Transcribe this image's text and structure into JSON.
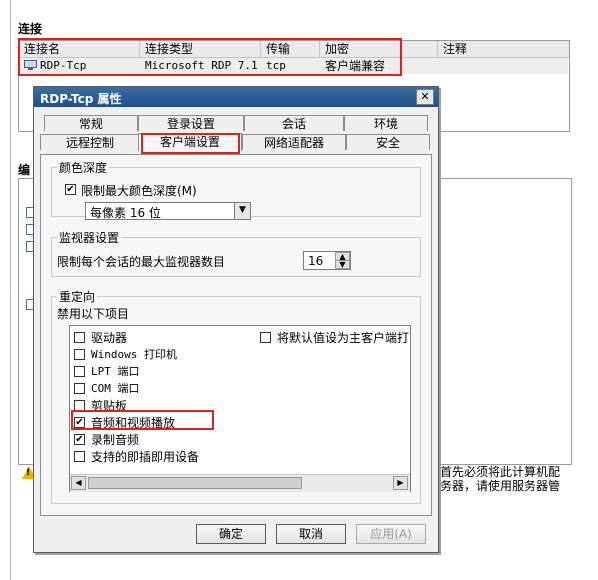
{
  "connections": {
    "title": "连接",
    "columns": [
      "连接名",
      "连接类型",
      "传输",
      "加密",
      "注释"
    ],
    "row": {
      "name": "RDP-Tcp",
      "type": "Microsoft RDP 7.1",
      "transport": "tcp",
      "encryption": "客户端兼容",
      "comment": ""
    }
  },
  "edit_title": "编",
  "warning": {
    "line1": "首先必须将此计算机配",
    "line2": "务器，请使用服务器管"
  },
  "dialog": {
    "title": "RDP-Tcp 属性",
    "close": "✕",
    "tabs_row1": [
      "常规",
      "登录设置",
      "会话",
      "环境"
    ],
    "tabs_row2": [
      "远程控制",
      "客户端设置",
      "网络适配器",
      "安全"
    ],
    "active_tab": "客户端设置",
    "color_depth": {
      "group": "颜色深度",
      "limit_label": "限制最大颜色深度(M)",
      "limit_checked": true,
      "value": "每像素 16 位"
    },
    "monitor": {
      "group": "监视器设置",
      "label": "限制每个会话的最大监视器数目",
      "value": "16"
    },
    "redirect": {
      "group": "重定向",
      "disable_label": "禁用以下项目",
      "items": [
        {
          "label": "驱动器",
          "checked": false
        },
        {
          "label": "Windows 打印机",
          "checked": false
        },
        {
          "label": "LPT 端口",
          "checked": false
        },
        {
          "label": "COM 端口",
          "checked": false
        },
        {
          "label": "剪贴板",
          "checked": false
        },
        {
          "label": "音频和视频播放",
          "checked": true
        },
        {
          "label": "录制音频",
          "checked": true
        },
        {
          "label": "支持的即插即用设备",
          "checked": false
        }
      ],
      "right_item": {
        "label": "将默认值设为主客户端打",
        "checked": false
      }
    },
    "buttons": {
      "ok": "确定",
      "cancel": "取消",
      "apply": "应用(A)"
    }
  },
  "colors": {
    "highlight_box": "#e0211b",
    "titlebar": "#2a5e97"
  }
}
